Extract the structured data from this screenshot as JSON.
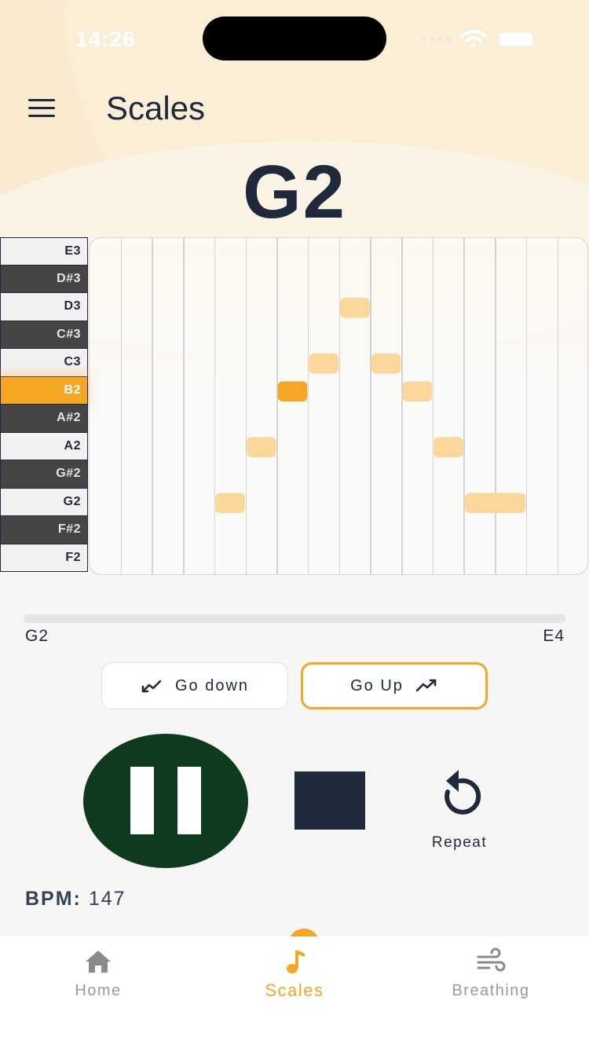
{
  "status_bar": {
    "time": "14:26"
  },
  "header": {
    "title": "Scales"
  },
  "current_note": "G2",
  "piano_keys": [
    {
      "label": "E3",
      "color": "white"
    },
    {
      "label": "D#3",
      "color": "black"
    },
    {
      "label": "D3",
      "color": "white"
    },
    {
      "label": "C#3",
      "color": "black"
    },
    {
      "label": "C3",
      "color": "white"
    },
    {
      "label": "B2",
      "color": "white",
      "active": true
    },
    {
      "label": "A#2",
      "color": "black"
    },
    {
      "label": "A2",
      "color": "white"
    },
    {
      "label": "G#2",
      "color": "black"
    },
    {
      "label": "G2",
      "color": "white"
    },
    {
      "label": "F#2",
      "color": "black"
    },
    {
      "label": "F2",
      "color": "white"
    }
  ],
  "scale_pattern": {
    "columns": 16,
    "notes": [
      {
        "col": 4,
        "note": "G2",
        "span": 1
      },
      {
        "col": 5,
        "note": "A2",
        "span": 1
      },
      {
        "col": 6,
        "note": "B2",
        "span": 1,
        "current": true
      },
      {
        "col": 7,
        "note": "C3",
        "span": 1
      },
      {
        "col": 8,
        "note": "D3",
        "span": 1
      },
      {
        "col": 9,
        "note": "C3",
        "span": 1
      },
      {
        "col": 10,
        "note": "B2",
        "span": 1
      },
      {
        "col": 11,
        "note": "A2",
        "span": 1
      },
      {
        "col": 12,
        "note": "G2",
        "span": 2
      }
    ]
  },
  "range": {
    "low": "G2",
    "high": "E4"
  },
  "direction": {
    "down_label": "Go down",
    "up_label": "Go Up",
    "selected": "up"
  },
  "controls": {
    "repeat_label": "Repeat"
  },
  "bpm": {
    "label": "BPM:",
    "value": "147"
  },
  "nav": [
    {
      "label": "Home",
      "icon": "home-icon"
    },
    {
      "label": "Scales",
      "icon": "music-note-icon",
      "active": true
    },
    {
      "label": "Breathing",
      "icon": "wind-icon"
    }
  ],
  "colors": {
    "accent": "#f5a623",
    "note_block": "#fbd79a",
    "note_current": "#f5a623",
    "pause_bg": "#0e3b1e",
    "text_dark": "#1e293b"
  }
}
